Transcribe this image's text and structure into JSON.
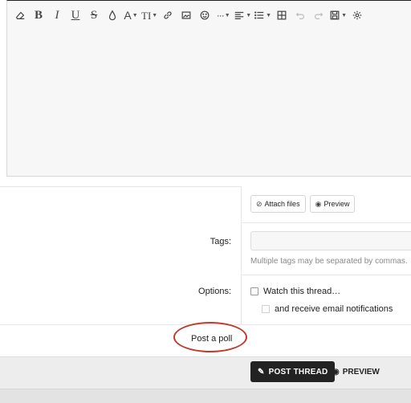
{
  "toolbar": {
    "bold": "B",
    "italic": "I",
    "underline": "U",
    "strike": "S",
    "font_size": "TI",
    "text_color": "A",
    "more": "···",
    "icons": [
      "eraser-icon",
      "bold-icon",
      "italic-icon",
      "underline-icon",
      "strikethrough-icon",
      "drop-icon",
      "text-color-icon",
      "font-size-icon",
      "link-icon",
      "image-icon",
      "smiley-icon",
      "more-icon",
      "align-icon",
      "list-icon",
      "table-icon",
      "undo-icon",
      "redo-icon",
      "save-draft-icon",
      "settings-icon"
    ]
  },
  "attachments": {
    "attach_label": "Attach files",
    "preview_label": "Preview"
  },
  "tags": {
    "label": "Tags:",
    "value": "",
    "hint": "Multiple tags may be separated by commas."
  },
  "options": {
    "label": "Options:",
    "watch_label": "Watch this thread…",
    "email_label": "and receive email notifications"
  },
  "poll": {
    "label": "Post a poll",
    "highlight_color": "#c0392b"
  },
  "footer": {
    "post_label": "POST THREAD",
    "preview_label": "PREVIEW"
  }
}
